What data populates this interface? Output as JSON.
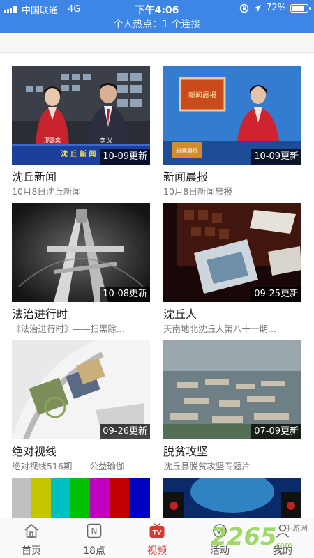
{
  "status_bar": {
    "carrier": "中国联通",
    "network": "4G",
    "time": "下午4:06",
    "battery": "72%",
    "battery_level": 0.72,
    "hotspot": "个人热点：1 个连接"
  },
  "videos": [
    {
      "title": "沈丘新闻",
      "subtitle": "10月8日沈丘新闻",
      "badge": "10-09更新"
    },
    {
      "title": "新闻晨报",
      "subtitle": "10月8日新闻晨报",
      "badge": "10-09更新"
    },
    {
      "title": "法治进行时",
      "subtitle": "《法治进行时》——扫黑除...",
      "badge": "10-08更新"
    },
    {
      "title": "沈丘人",
      "subtitle": "天南地北沈丘人第八十一期...",
      "badge": "09-25更新"
    },
    {
      "title": "绝对视线",
      "subtitle": "绝对视线516期——公益瑜伽",
      "badge": "09-26更新"
    },
    {
      "title": "脱贫攻坚",
      "subtitle": "沈丘县脱贫攻坚专题片",
      "badge": "07-09更新"
    }
  ],
  "thumb_text": {
    "anchor_left": "邢露奕",
    "anchor_right": "李 光",
    "ticker": "沈 丘 新 闻",
    "studio_sign": "新闻晨报",
    "desk_sign": "新闻晨报"
  },
  "tabs": [
    {
      "label": "首页",
      "icon": "home-icon"
    },
    {
      "label": "18点",
      "icon": "n-icon",
      "glyph": "N"
    },
    {
      "label": "视频",
      "icon": "tv-icon",
      "glyph": "TV",
      "active": true
    },
    {
      "label": "活动",
      "icon": "activity-icon"
    },
    {
      "label": "我的",
      "icon": "profile-icon"
    }
  ],
  "watermark": {
    "number": "2265",
    "suffix": ".com",
    "brand": "手游网"
  },
  "colors": {
    "accent": "#d43a2f",
    "status_bar": "#3d86e6"
  }
}
